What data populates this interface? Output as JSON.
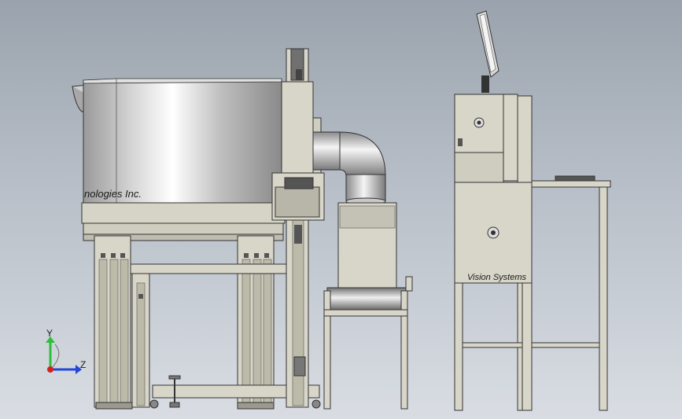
{
  "scene": {
    "bowl_label": "nologies Inc.",
    "cabinet_label": "Vision Systems"
  },
  "triad": {
    "y_label": "Y",
    "z_label": "Z"
  },
  "colors": {
    "frame": "#d8d6c8",
    "frame_dark": "#7e7c70",
    "steel_light": "#f2f2f2",
    "steel_dark": "#8d8d8d",
    "axis_y": "#2bbf3a",
    "axis_z": "#2646d8",
    "axis_x": "#d42020"
  }
}
